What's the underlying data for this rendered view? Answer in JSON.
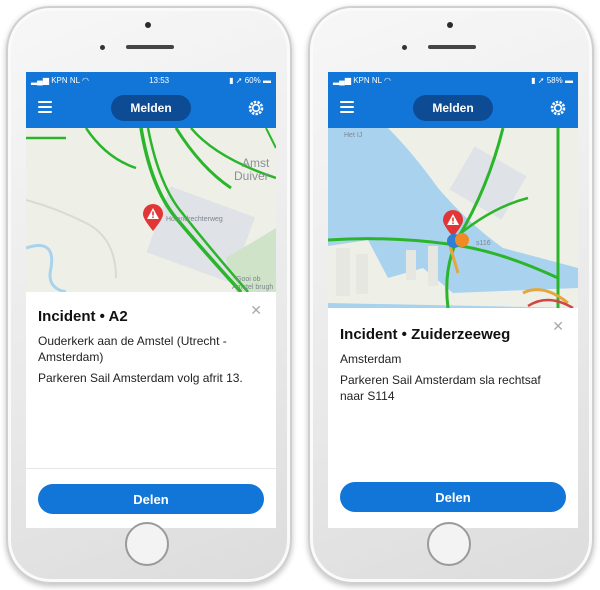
{
  "colors": {
    "accent": "#1276d8",
    "button_dark": "#0d4c94",
    "map_land": "#eef0e7",
    "water": "#a9d2ee",
    "traffic_green": "#2bb52b"
  },
  "phones": [
    {
      "status": {
        "carrier": "KPN NL",
        "time": "13:53",
        "battery": "60%"
      },
      "nav": {
        "report_label": "Melden"
      },
      "map": {
        "place_label": "Amst",
        "place_label2": "Duiver",
        "small_labels": [
          "Holendrechterweg",
          "Gooi ob",
          "Amstel brugh"
        ]
      },
      "incident": {
        "title": "Incident • A2",
        "location": "Ouderkerk aan de Amstel (Utrecht - Amsterdam)",
        "message": "Parkeren Sail Amsterdam volg afrit 13."
      },
      "share_label": "Delen"
    },
    {
      "status": {
        "carrier": "KPN NL",
        "time": "",
        "battery": "58%"
      },
      "nav": {
        "report_label": "Melden"
      },
      "map": {
        "small_labels": [
          "Het IJ",
          "s116",
          "Zuiderzeeweg"
        ]
      },
      "incident": {
        "title": "Incident • Zuiderzeeweg",
        "location": "Amsterdam",
        "message": "Parkeren Sail Amsterdam sla rechtsaf naar S114"
      },
      "share_label": "Delen"
    }
  ]
}
